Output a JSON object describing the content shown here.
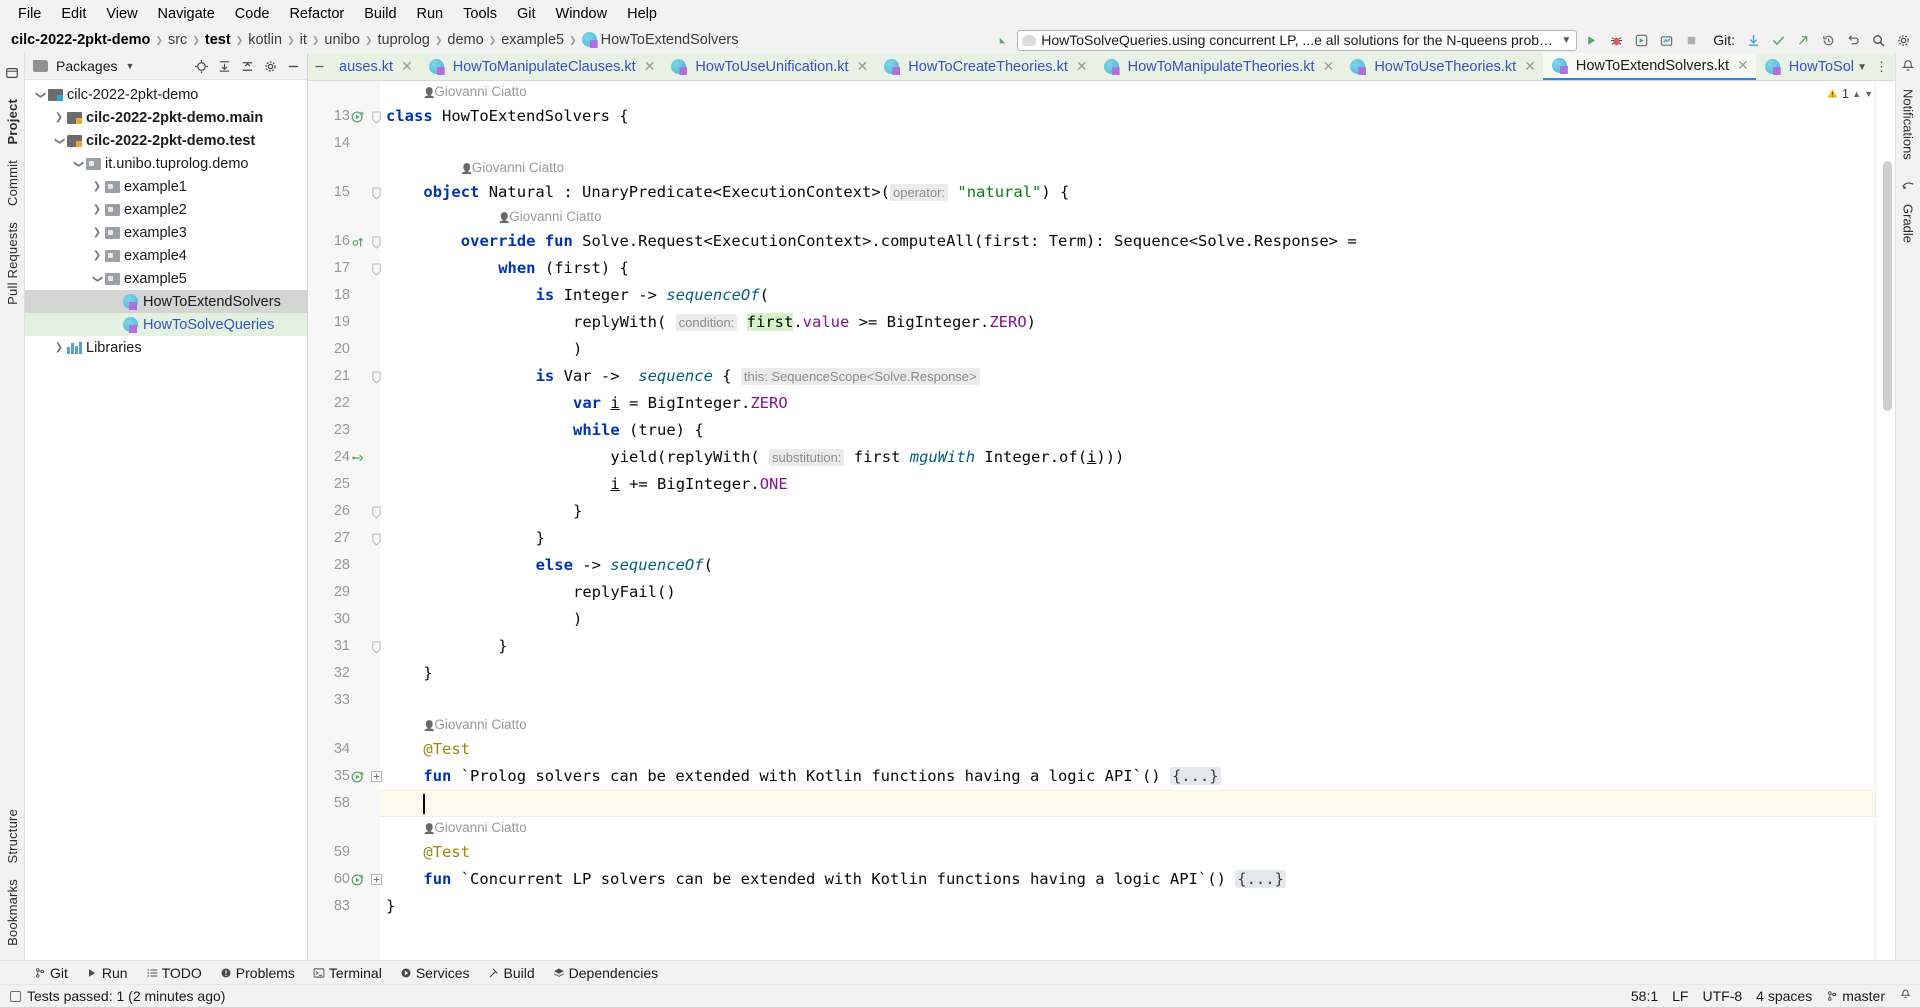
{
  "menubar": {
    "items": [
      "File",
      "Edit",
      "View",
      "Navigate",
      "Code",
      "Refactor",
      "Build",
      "Run",
      "Tools",
      "Git",
      "Window",
      "Help"
    ]
  },
  "breadcrumb": {
    "items": [
      {
        "label": "cilc-2022-2pkt-demo",
        "bold": true
      },
      {
        "label": "src",
        "bold": false
      },
      {
        "label": "test",
        "bold": true
      },
      {
        "label": "kotlin",
        "bold": false
      },
      {
        "label": "it",
        "bold": false
      },
      {
        "label": "unibo",
        "bold": false
      },
      {
        "label": "tuprolog",
        "bold": false
      },
      {
        "label": "demo",
        "bold": false
      },
      {
        "label": "example5",
        "bold": false
      },
      {
        "label": "HowToExtendSolvers",
        "bold": false,
        "icon": "kotlin-file-icon"
      }
    ]
  },
  "toolbar": {
    "run_config": "HowToSolveQueries.using concurrent LP, ...e all solutions for the N-queens problem",
    "run_config_icon": "gradle-elephant-icon",
    "git_label": "Git:",
    "buttons": [
      {
        "name": "run-button",
        "glyph": "▶"
      },
      {
        "name": "debug-button",
        "glyph": "🐞"
      },
      {
        "name": "run-with-coverage-button",
        "glyph": "▣"
      },
      {
        "name": "profiler-button",
        "glyph": "◳"
      },
      {
        "name": "stop-button",
        "glyph": "■"
      }
    ],
    "git_buttons": [
      {
        "name": "update-project-button",
        "glyph": "⤓"
      },
      {
        "name": "commit-button",
        "glyph": "✓"
      },
      {
        "name": "push-button",
        "glyph": "↗"
      },
      {
        "name": "history-button",
        "glyph": "↺"
      },
      {
        "name": "rollback-button",
        "glyph": "↶"
      },
      {
        "name": "search-everywhere-button",
        "glyph": "🔍"
      },
      {
        "name": "settings-button",
        "glyph": "⚙"
      }
    ]
  },
  "left_rail": {
    "top": [
      "Project"
    ],
    "right_side_labels": [
      "Commit",
      "Pull Requests"
    ],
    "bottom": [
      "Bookmarks",
      "Structure"
    ]
  },
  "right_rail": {
    "labels": [
      "Notifications",
      "Gradle"
    ]
  },
  "project_panel": {
    "header_title": "Packages",
    "header_icons": [
      "folder-icon",
      "chevron-down-icon",
      "locate-icon",
      "expand-all-icon",
      "collapse-all-icon",
      "gear-icon",
      "hide-icon"
    ],
    "tree": [
      {
        "label": "cilc-2022-2pkt-demo",
        "depth": 0,
        "arrow": "v",
        "icon": "module-group-icon",
        "bold": false,
        "state": "none"
      },
      {
        "label": "cilc-2022-2pkt-demo.main",
        "depth": 1,
        "arrow": ">",
        "icon": "module-icon-orange",
        "bold": true,
        "state": "none"
      },
      {
        "label": "cilc-2022-2pkt-demo.test",
        "depth": 1,
        "arrow": "v",
        "icon": "module-icon-orange",
        "bold": true,
        "state": "none"
      },
      {
        "label": "it.unibo.tuprolog.demo",
        "depth": 2,
        "arrow": "v",
        "icon": "package-icon",
        "bold": false,
        "state": "none"
      },
      {
        "label": "example1",
        "depth": 3,
        "arrow": ">",
        "icon": "package-icon",
        "bold": false,
        "state": "none"
      },
      {
        "label": "example2",
        "depth": 3,
        "arrow": ">",
        "icon": "package-icon",
        "bold": false,
        "state": "none"
      },
      {
        "label": "example3",
        "depth": 3,
        "arrow": ">",
        "icon": "package-icon",
        "bold": false,
        "state": "none"
      },
      {
        "label": "example4",
        "depth": 3,
        "arrow": ">",
        "icon": "package-icon",
        "bold": false,
        "state": "none"
      },
      {
        "label": "example5",
        "depth": 3,
        "arrow": "v",
        "icon": "package-icon",
        "bold": false,
        "state": "none"
      },
      {
        "label": "HowToExtendSolvers",
        "depth": 4,
        "arrow": "",
        "icon": "kotlin-class-icon",
        "bold": false,
        "state": "selected"
      },
      {
        "label": "HowToSolveQueries",
        "depth": 4,
        "arrow": "",
        "icon": "kotlin-class-icon",
        "bold": false,
        "state": "highlighted"
      },
      {
        "label": "Libraries",
        "depth": 1,
        "arrow": ">",
        "icon": "libraries-icon",
        "bold": false,
        "state": "none"
      }
    ]
  },
  "editor_tabs": {
    "tabs": [
      {
        "label": "auses.kt",
        "active": false,
        "truncated": true
      },
      {
        "label": "HowToManipulateClauses.kt",
        "active": false
      },
      {
        "label": "HowToUseUnification.kt",
        "active": false
      },
      {
        "label": "HowToCreateTheories.kt",
        "active": false
      },
      {
        "label": "HowToManipulateTheories.kt",
        "active": false
      },
      {
        "label": "HowToUseTheories.kt",
        "active": false
      },
      {
        "label": "HowToExtendSolvers.kt",
        "active": true
      },
      {
        "label": "HowToSolveQueries.kt",
        "active": false
      }
    ],
    "right_icons": [
      "chevron-down-icon",
      "more-icon"
    ]
  },
  "editor": {
    "warning_count": "1",
    "warning_icon": "warning-triangle-icon",
    "inspection_icons": [
      "chevron-up-icon",
      "chevron-down-icon"
    ],
    "lines": [
      {
        "num": "",
        "type": "author",
        "indent": 1,
        "text": "Giovanni Ciatto"
      },
      {
        "num": "13",
        "type": "code",
        "gutter_icon": "run-test-class-icon",
        "fold": "v",
        "indent": 0,
        "tokens": [
          {
            "t": "class ",
            "c": "kw"
          },
          {
            "t": "HowToExtendSolvers {",
            "c": "plain"
          }
        ]
      },
      {
        "num": "14",
        "type": "code",
        "indent": 0,
        "tokens": []
      },
      {
        "num": "",
        "type": "author",
        "indent": 2,
        "text": "Giovanni Ciatto"
      },
      {
        "num": "15",
        "type": "code",
        "fold": "v",
        "indent": 1,
        "tokens": [
          {
            "t": "object ",
            "c": "kw"
          },
          {
            "t": "Natural : UnaryPredicate<ExecutionContext>(",
            "c": "plain"
          },
          {
            "t": "operator:",
            "c": "hint"
          },
          {
            "t": " ",
            "c": "plain"
          },
          {
            "t": "\"natural\"",
            "c": "str"
          },
          {
            "t": ") {",
            "c": "plain"
          }
        ]
      },
      {
        "num": "",
        "type": "author",
        "indent": 3,
        "text": "Giovanni Ciatto"
      },
      {
        "num": "16",
        "type": "code",
        "gutter_icon": "override-icon",
        "fold": "v",
        "indent": 2,
        "tokens": [
          {
            "t": "override fun ",
            "c": "kw"
          },
          {
            "t": "Solve.Request<ExecutionContext>.computeAll(first: Term): Sequence<Solve.Response> =",
            "c": "plain"
          }
        ]
      },
      {
        "num": "17",
        "type": "code",
        "fold": "v",
        "indent": 3,
        "tokens": [
          {
            "t": "when ",
            "c": "kw"
          },
          {
            "t": "(first) {",
            "c": "plain"
          }
        ]
      },
      {
        "num": "18",
        "type": "code",
        "indent": 4,
        "tokens": [
          {
            "t": "is ",
            "c": "kw"
          },
          {
            "t": "Integer -> ",
            "c": "plain"
          },
          {
            "t": "sequenceOf",
            "c": "fn"
          },
          {
            "t": "(",
            "c": "plain"
          }
        ]
      },
      {
        "num": "19",
        "type": "code",
        "indent": 5,
        "tokens": [
          {
            "t": "replyWith( ",
            "c": "plain"
          },
          {
            "t": "condition:",
            "c": "hint"
          },
          {
            "t": " ",
            "c": "plain"
          },
          {
            "t": "first",
            "c": "hl"
          },
          {
            "t": ".",
            "c": "plain"
          },
          {
            "t": "value",
            "c": "prop"
          },
          {
            "t": " >= BigInteger.",
            "c": "plain"
          },
          {
            "t": "ZERO",
            "c": "prop"
          },
          {
            "t": ")",
            "c": "plain"
          }
        ]
      },
      {
        "num": "20",
        "type": "code",
        "indent": 5,
        "tokens": [
          {
            "t": ")",
            "c": "plain"
          }
        ]
      },
      {
        "num": "21",
        "type": "code",
        "fold": "v",
        "indent": 4,
        "tokens": [
          {
            "t": "is ",
            "c": "kw"
          },
          {
            "t": "Var ->  ",
            "c": "plain"
          },
          {
            "t": "sequence",
            "c": "fn"
          },
          {
            "t": " { ",
            "c": "plain"
          },
          {
            "t": "this: SequenceScope<Solve.Response>",
            "c": "hint"
          }
        ]
      },
      {
        "num": "22",
        "type": "code",
        "indent": 5,
        "tokens": [
          {
            "t": "var ",
            "c": "kw"
          },
          {
            "t": "i",
            "c": "ul"
          },
          {
            "t": " = BigInteger.",
            "c": "plain"
          },
          {
            "t": "ZERO",
            "c": "prop"
          }
        ]
      },
      {
        "num": "23",
        "type": "code",
        "indent": 5,
        "tokens": [
          {
            "t": "while ",
            "c": "kw"
          },
          {
            "t": "(true) {",
            "c": "plain"
          }
        ]
      },
      {
        "num": "24",
        "type": "code",
        "gutter_icon": "modified-icon",
        "indent": 6,
        "tokens": [
          {
            "t": "yield(replyWith( ",
            "c": "plain"
          },
          {
            "t": "substitution:",
            "c": "hint"
          },
          {
            "t": " first ",
            "c": "plain"
          },
          {
            "t": "mguWith",
            "c": "fn"
          },
          {
            "t": " Integer.of(",
            "c": "plain"
          },
          {
            "t": "i",
            "c": "ul"
          },
          {
            "t": ")))",
            "c": "plain"
          }
        ]
      },
      {
        "num": "25",
        "type": "code",
        "indent": 6,
        "tokens": [
          {
            "t": "i",
            "c": "ul"
          },
          {
            "t": " += BigInteger.",
            "c": "plain"
          },
          {
            "t": "ONE",
            "c": "prop"
          }
        ]
      },
      {
        "num": "26",
        "type": "code",
        "fold": "v",
        "indent": 5,
        "tokens": [
          {
            "t": "}",
            "c": "plain"
          }
        ]
      },
      {
        "num": "27",
        "type": "code",
        "fold": "v",
        "indent": 4,
        "tokens": [
          {
            "t": "}",
            "c": "plain"
          }
        ]
      },
      {
        "num": "28",
        "type": "code",
        "indent": 4,
        "tokens": [
          {
            "t": "else ",
            "c": "kw"
          },
          {
            "t": "-> ",
            "c": "plain"
          },
          {
            "t": "sequenceOf",
            "c": "fn"
          },
          {
            "t": "(",
            "c": "plain"
          }
        ]
      },
      {
        "num": "29",
        "type": "code",
        "indent": 5,
        "tokens": [
          {
            "t": "replyFail()",
            "c": "plain"
          }
        ]
      },
      {
        "num": "30",
        "type": "code",
        "indent": 5,
        "tokens": [
          {
            "t": ")",
            "c": "plain"
          }
        ]
      },
      {
        "num": "31",
        "type": "code",
        "fold": "v",
        "indent": 3,
        "tokens": [
          {
            "t": "}",
            "c": "plain"
          }
        ]
      },
      {
        "num": "32",
        "type": "code",
        "indent": 1,
        "tokens": [
          {
            "t": "}",
            "c": "plain"
          }
        ]
      },
      {
        "num": "33",
        "type": "code",
        "indent": 0,
        "tokens": []
      },
      {
        "num": "",
        "type": "author",
        "indent": 1,
        "text": "Giovanni Ciatto"
      },
      {
        "num": "34",
        "type": "code",
        "indent": 1,
        "tokens": [
          {
            "t": "@Test",
            "c": "ann"
          }
        ]
      },
      {
        "num": "35",
        "type": "code",
        "gutter_icon": "run-test-icon",
        "fold": "+",
        "indent": 1,
        "tokens": [
          {
            "t": "fun ",
            "c": "kw"
          },
          {
            "t": "`Prolog solvers can be extended with Kotlin functions having a logic API`() ",
            "c": "plain"
          },
          {
            "t": "{...}",
            "c": "fold"
          }
        ]
      },
      {
        "num": "58",
        "type": "caret",
        "indent": 1,
        "tokens": []
      },
      {
        "num": "",
        "type": "author",
        "indent": 1,
        "text": "Giovanni Ciatto"
      },
      {
        "num": "59",
        "type": "code",
        "indent": 1,
        "tokens": [
          {
            "t": "@Test",
            "c": "ann"
          }
        ]
      },
      {
        "num": "60",
        "type": "code",
        "gutter_icon": "run-test-icon",
        "fold": "+",
        "indent": 1,
        "tokens": [
          {
            "t": "fun ",
            "c": "kw"
          },
          {
            "t": "`Concurrent LP solvers can be extended with Kotlin functions having a logic API`() ",
            "c": "plain"
          },
          {
            "t": "{...}",
            "c": "fold"
          }
        ]
      },
      {
        "num": "83",
        "type": "code",
        "indent": 0,
        "tokens": [
          {
            "t": "}",
            "c": "plain"
          }
        ]
      }
    ]
  },
  "bottom_toolwindows": [
    {
      "label": "Git",
      "icon": "git-branch-icon"
    },
    {
      "label": "Run",
      "icon": "play-icon"
    },
    {
      "label": "TODO",
      "icon": "list-icon"
    },
    {
      "label": "Problems",
      "icon": "error-circle-icon"
    },
    {
      "label": "Terminal",
      "icon": "terminal-icon"
    },
    {
      "label": "Services",
      "icon": "services-icon"
    },
    {
      "label": "Build",
      "icon": "hammer-icon"
    },
    {
      "label": "Dependencies",
      "icon": "layers-icon"
    }
  ],
  "status_bar": {
    "message": "Tests passed: 1 (2 minutes ago)",
    "message_icon": "window-icon",
    "caret_position": "58:1",
    "line_separator": "LF",
    "encoding": "UTF-8",
    "indent": "4 spaces",
    "branch": "master",
    "branch_icon": "git-branch-icon",
    "notification_icon": "bell-icon"
  },
  "colors": {
    "tab_strip_bg": "#e9f0e4",
    "active_tab_bg": "#f6faf2",
    "link_blue": "#2f55c4",
    "keyword_blue": "#0033b3",
    "string_green": "#067d17",
    "property_purple": "#871094",
    "function_teal": "#00627a",
    "annotation_yellow": "#9e880d",
    "highlight_green": "#d4f3c8",
    "caret_line": "#fcfaed"
  }
}
